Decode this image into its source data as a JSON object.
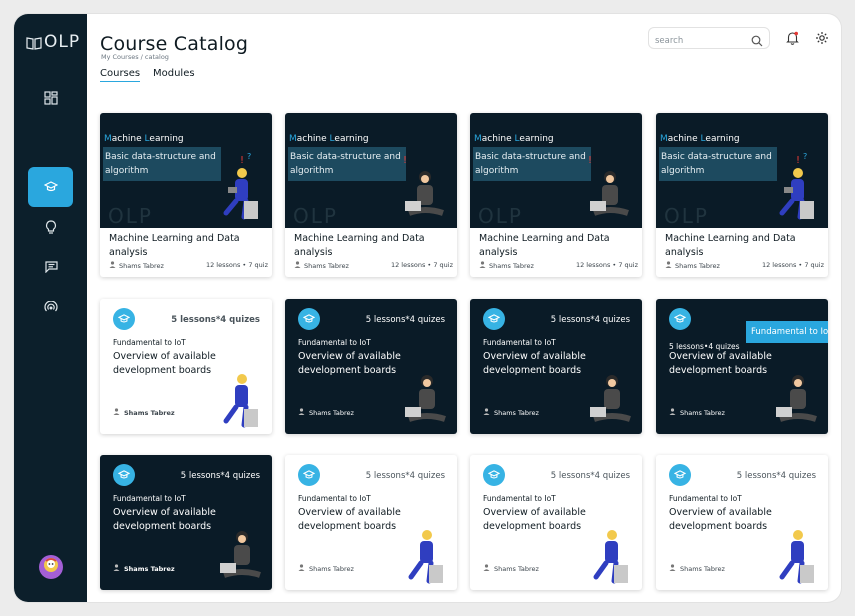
{
  "app": {
    "logo_text": "OLP"
  },
  "header": {
    "title": "Course Catalog",
    "breadcrumb": "My Courses / catalog",
    "tabs": [
      {
        "label": "Courses",
        "active": true
      },
      {
        "label": "Modules",
        "active": false
      }
    ],
    "search": {
      "placeholder": "search",
      "value": ""
    }
  },
  "sidebar": {
    "items": [
      {
        "icon": "grid-icon",
        "active": false
      },
      {
        "icon": "graduation-cap-icon",
        "active": true
      },
      {
        "icon": "lightbulb-icon",
        "active": false
      },
      {
        "icon": "chat-icon",
        "active": false
      },
      {
        "icon": "broadcast-icon",
        "active": false
      }
    ],
    "avatar_icon": "user-avatar-icon"
  },
  "colors": {
    "sidebar": "#0c1f2b",
    "accent": "#2aa7de",
    "dark_card": "#0a1b27"
  },
  "ml_cards": [
    {
      "banner_title_initial_1": "M",
      "banner_title_rest_1": "achine ",
      "banner_title_initial_2": "L",
      "banner_title_rest_2": "earning",
      "banner_sub": "Basic data-structure and algorithm",
      "watermark": "OLP",
      "title": "Machine Learning and Data analysis",
      "author": "Shams Tabrez",
      "stats": "12 lessons • 7 quiz"
    },
    {
      "banner_title_initial_1": "M",
      "banner_title_rest_1": "achine ",
      "banner_title_initial_2": "L",
      "banner_title_rest_2": "earning",
      "banner_sub": "Basic data-structure and algorithm",
      "watermark": "OLP",
      "title": "Machine Learning and Data analysis",
      "author": "Shams Tabrez",
      "stats": "12 lessons • 7 quiz"
    },
    {
      "banner_title_initial_1": "M",
      "banner_title_rest_1": "achine ",
      "banner_title_initial_2": "L",
      "banner_title_rest_2": "earning",
      "banner_sub": "Basic data-structure and algorithm",
      "watermark": "OLP",
      "title": "Machine Learning and Data analysis",
      "author": "Shams Tabrez",
      "stats": "12 lessons • 7 quiz"
    },
    {
      "banner_title_initial_1": "M",
      "banner_title_rest_1": "achine ",
      "banner_title_initial_2": "L",
      "banner_title_rest_2": "earning",
      "banner_sub": "Basic data-structure and algorithm",
      "watermark": "OLP",
      "title": "Machine Learning and Data analysis",
      "author": "Shams Tabrez",
      "stats": "12 lessons • 7 quiz"
    }
  ],
  "iot_row1": [
    {
      "theme": "light",
      "counts": "5 lessons*4 quizes",
      "topic": "Fundamental to IoT",
      "heading": "Overview of available development boards",
      "author": "Shams Tabrez"
    },
    {
      "theme": "dark",
      "counts": "5 lessons*4 quizes",
      "topic": "Fundamental to IoT",
      "heading": "Overview of available development boards",
      "author": "Shams Tabrez"
    },
    {
      "theme": "dark",
      "counts": "5 lessons*4 quizes",
      "topic": "Fundamental to IoT",
      "heading": "Overview of available development boards",
      "author": "Shams Tabrez"
    },
    {
      "theme": "dark",
      "counts": "5 lessons•4 quizes",
      "topic": "Fundamental to IoT",
      "heading": "Overview of available development boards",
      "author": "Shams Tabrez",
      "overlay": "Fundamental to IoT"
    }
  ],
  "iot_row2": [
    {
      "theme": "dark",
      "counts": "5 lessons*4 quizes",
      "topic": "Fundamental to IoT",
      "heading": "Overview of available development boards",
      "author": "Shams Tabrez"
    },
    {
      "theme": "light",
      "counts": "5 lessons*4 quizes",
      "topic": "Fundamental to IoT",
      "heading": "Overview of available development boards",
      "author": "Shams Tabrez"
    },
    {
      "theme": "light",
      "counts": "5 lessons*4 quizes",
      "topic": "Fundamental to IoT",
      "heading": "Overview of available development boards",
      "author": "Shams Tabrez"
    },
    {
      "theme": "light",
      "counts": "5 lessons*4 quizes",
      "topic": "Fundamental to IoT",
      "heading": "Overview of available development boards",
      "author": "Shams Tabrez"
    }
  ]
}
